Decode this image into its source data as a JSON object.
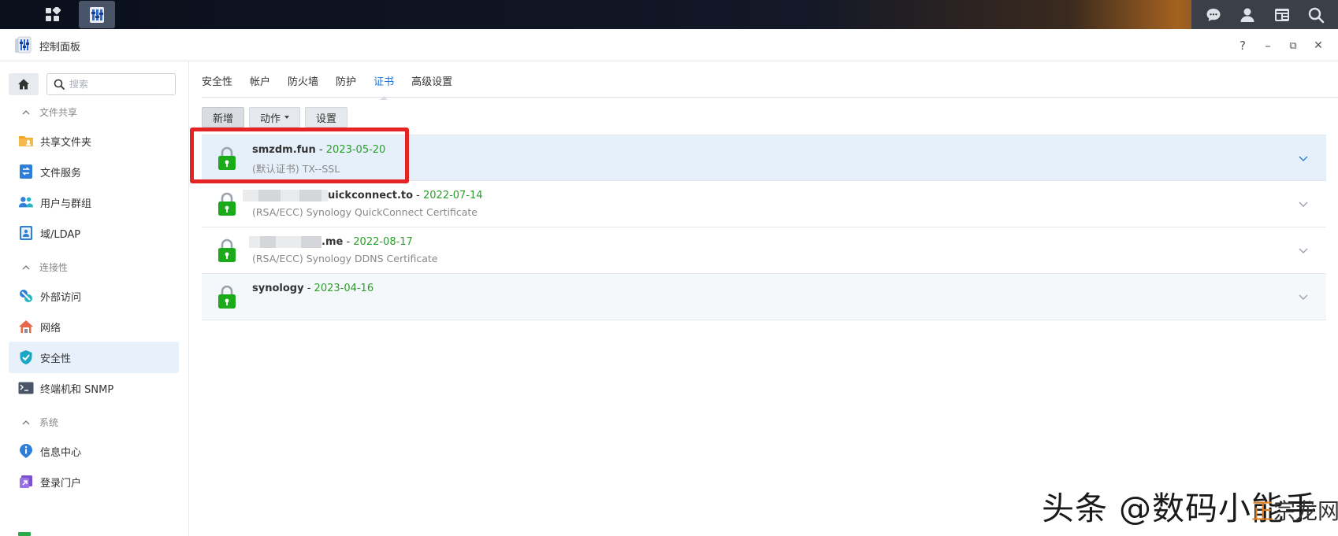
{
  "window": {
    "title": "控制面板"
  },
  "window_controls": {
    "help": "?",
    "minimize": "–",
    "restore": "⧉",
    "close": "✕"
  },
  "sidebar": {
    "search_placeholder": "搜索",
    "sections": [
      {
        "label": "文件共享",
        "items": [
          {
            "label": "共享文件夹",
            "icon": "shared-folder-icon"
          },
          {
            "label": "文件服务",
            "icon": "file-services-icon"
          },
          {
            "label": "用户与群组",
            "icon": "users-groups-icon"
          },
          {
            "label": "域/LDAP",
            "icon": "domain-ldap-icon"
          }
        ]
      },
      {
        "label": "连接性",
        "items": [
          {
            "label": "外部访问",
            "icon": "external-access-icon"
          },
          {
            "label": "网络",
            "icon": "network-icon"
          },
          {
            "label": "安全性",
            "icon": "security-shield-icon",
            "active": true
          },
          {
            "label": "终端机和 SNMP",
            "icon": "terminal-icon"
          }
        ]
      },
      {
        "label": "系统",
        "items": [
          {
            "label": "信息中心",
            "icon": "info-center-icon"
          },
          {
            "label": "登录门户",
            "icon": "login-portal-icon"
          }
        ]
      }
    ]
  },
  "tabs": [
    {
      "label": "安全性"
    },
    {
      "label": "帐户"
    },
    {
      "label": "防火墙"
    },
    {
      "label": "防护"
    },
    {
      "label": "证书",
      "active": true
    },
    {
      "label": "高级设置"
    }
  ],
  "toolbar": {
    "add": "新增",
    "action": "动作",
    "settings": "设置"
  },
  "certificates": [
    {
      "name": "smzdm.fun",
      "sep": " - ",
      "date": "2023-05-20",
      "desc": "(默认证书) TX--SSL"
    },
    {
      "name": "uickconnect.to",
      "sep": " - ",
      "date": "2022-07-14",
      "desc": "(RSA/ECC) Synology QuickConnect Certificate"
    },
    {
      "name": ".me",
      "sep": " - ",
      "date": "2022-08-17",
      "desc": "(RSA/ECC) Synology DDNS Certificate"
    },
    {
      "name": "synology",
      "sep": " - ",
      "date": "2023-04-16",
      "desc": ""
    }
  ],
  "watermark": {
    "main": "头条 @数码小能手",
    "overlay_a": "正",
    "overlay_b": "宗龙网"
  },
  "colors": {
    "accent": "#1d76d6",
    "date": "#2a9d2a",
    "lock": "#1aaa1a",
    "highlight": "#e42424",
    "selected_row": "#e6f0fb"
  }
}
